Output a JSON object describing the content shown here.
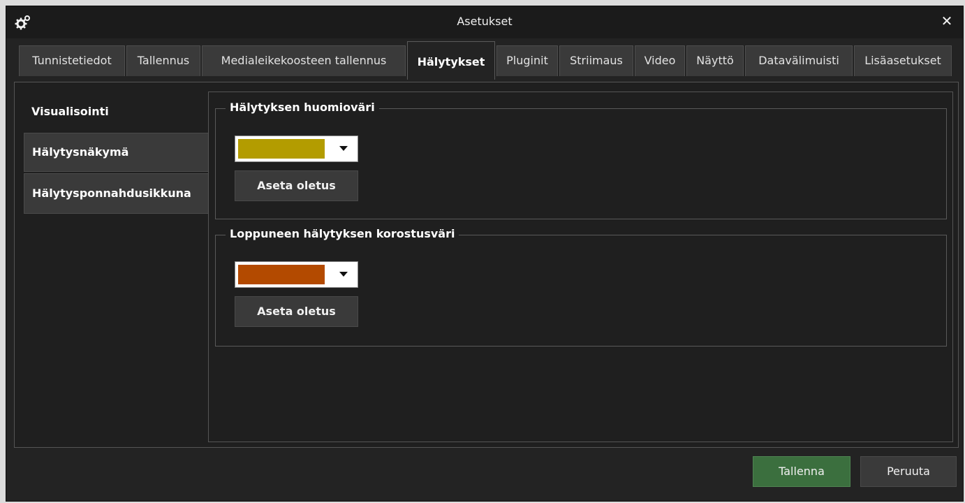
{
  "window": {
    "title": "Asetukset",
    "close_glyph": "✕"
  },
  "tabs": [
    {
      "label": "Tunnistetiedot"
    },
    {
      "label": "Tallennus"
    },
    {
      "label": "Medialeikekoosteen tallennus"
    },
    {
      "label": "Hälytykset",
      "active": true
    },
    {
      "label": "Pluginit"
    },
    {
      "label": "Striimaus"
    },
    {
      "label": "Video"
    },
    {
      "label": "Näyttö"
    },
    {
      "label": "Datavälimuisti"
    },
    {
      "label": "Lisäasetukset"
    }
  ],
  "sidebar": {
    "items": [
      {
        "label": "Visualisointi",
        "selected": true
      },
      {
        "label": "Hälytysnäkymä"
      },
      {
        "label": "Hälytysponnahdusikkuna"
      }
    ]
  },
  "groups": {
    "attention": {
      "legend": "Hälytyksen huomioväri",
      "color": "#b39c00",
      "reset_label": "Aseta oletus"
    },
    "expired": {
      "legend": "Loppuneen hälytyksen korostusväri",
      "color": "#b34a00",
      "reset_label": "Aseta oletus"
    }
  },
  "footer": {
    "save_label": "Tallenna",
    "cancel_label": "Peruuta"
  },
  "icons": {
    "settings": "gears-icon",
    "close": "close-icon",
    "dropdown": "chevron-down-icon"
  }
}
